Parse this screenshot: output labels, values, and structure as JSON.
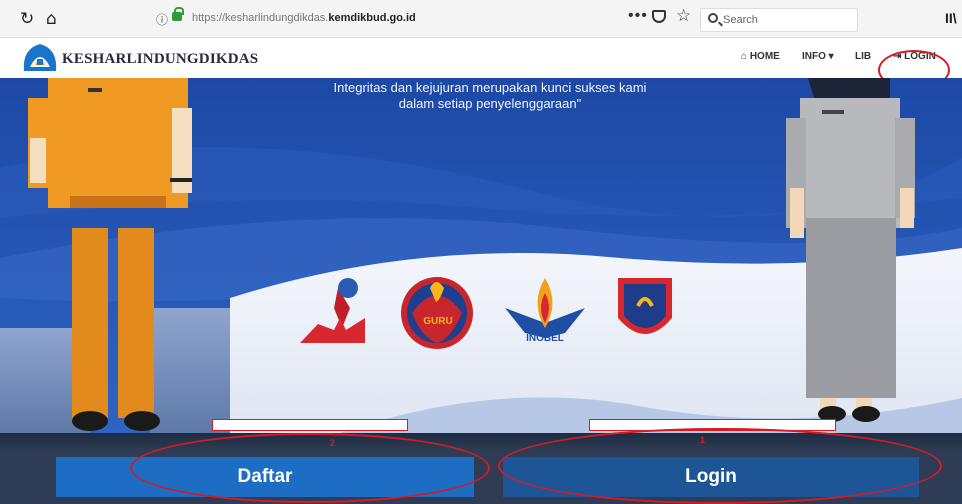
{
  "browser": {
    "reload_icon": "reload-icon",
    "home_icon": "home-icon",
    "url_host": "https://kesharlindungdikdas.",
    "url_domain": "kemdikbud.go.id",
    "more_label": "•••",
    "search_placeholder": "Search",
    "library_label": "II\\"
  },
  "site": {
    "brand": "KESHARLINDUNGDIKDAS",
    "nav": {
      "home": "HOME",
      "info": "INFO",
      "lib": "LIB",
      "login": "LOGIN"
    }
  },
  "hero": {
    "tagline_1": "Integritas dan kejujuran merupakan kunci sukses kami",
    "tagline_2": "dalam setiap penyelenggaraan\"",
    "logos": [
      {
        "name": "award-logo",
        "text": ""
      },
      {
        "name": "guru-logo",
        "text": "GURU"
      },
      {
        "name": "inobel-logo",
        "text": "INOBEL"
      },
      {
        "name": "shield-logo",
        "text": ""
      }
    ]
  },
  "actions": {
    "daftar_label": "Daftar",
    "login_label": "Login",
    "daftar_marker": "2",
    "login_marker": "1"
  },
  "colors": {
    "daftar": "#1e6dc4",
    "login": "#1d5596",
    "annotation": "#d41c24"
  }
}
